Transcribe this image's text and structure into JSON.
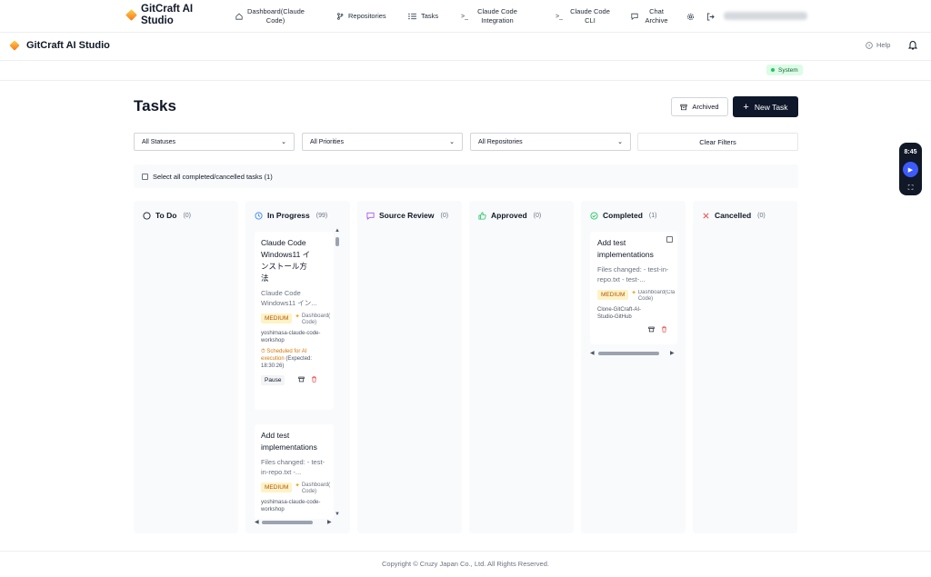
{
  "app": {
    "brand": "GitCraft AI Studio",
    "sub_brand": "GitCraft AI Studio"
  },
  "topnav": {
    "items": [
      {
        "label": "Dashboard(Claude Code)",
        "icon": "home-icon"
      },
      {
        "label": "Repositories",
        "icon": "branch-icon"
      },
      {
        "label": "Tasks",
        "icon": "list-icon"
      },
      {
        "label": "Claude Code Integration",
        "icon": "terminal-icon"
      },
      {
        "label": "Claude Code CLI",
        "icon": "terminal-icon"
      },
      {
        "label": "Chat Archive",
        "icon": "chat-icon"
      }
    ],
    "settings_icon": "gear-icon",
    "logout_icon": "logout-icon"
  },
  "subheader": {
    "help": "Help",
    "bell_icon": "bell-icon"
  },
  "system_badge": "System",
  "page": {
    "title": "Tasks",
    "archived_button": "Archived",
    "new_task_button": "New Task"
  },
  "filters": {
    "status": "All Statuses",
    "priority": "All Priorities",
    "repository": "All Repositories",
    "clear": "Clear Filters"
  },
  "select_all": "Select all completed/cancelled tasks (1)",
  "columns": [
    {
      "title": "To Do",
      "count": "(0)",
      "icon": "circle-icon",
      "color": "#111827"
    },
    {
      "title": "In Progress",
      "count": "(99)",
      "icon": "clock-icon",
      "color": "#3b82f6"
    },
    {
      "title": "Source Review",
      "count": "(0)",
      "icon": "message-icon",
      "color": "#a855f7"
    },
    {
      "title": "Approved",
      "count": "(0)",
      "icon": "thumbs-up-icon",
      "color": "#22c55e"
    },
    {
      "title": "Completed",
      "count": "(1)",
      "icon": "check-circle-icon",
      "color": "#22c55e"
    },
    {
      "title": "Cancelled",
      "count": "(0)",
      "icon": "x-icon",
      "color": "#ef4444"
    }
  ],
  "in_progress_cards": [
    {
      "title": "Claude Code Windows11 インストール方法",
      "desc": "Claude Code Windows11 イン...",
      "priority": "MEDIUM",
      "repo_tag": "Dashboard( Code)",
      "repo": "yoshimasa-claude-code-workshop",
      "scheduled": "Scheduled for AI execution",
      "expected": "(Expected: 18:30:26)",
      "pause": "Pause"
    },
    {
      "title": "Add test implementations",
      "desc": "Files changed: - test-in-repo.txt -...",
      "priority": "MEDIUM",
      "repo_tag": "Dashboard( Code)",
      "repo": "yoshimasa-claude-code-workshop"
    }
  ],
  "completed_card": {
    "title": "Add test implementations",
    "desc": "Files changed: - test-in-repo.txt - test-...",
    "priority": "MEDIUM",
    "repo_tag": "Dashboard(Cla Code)",
    "repo": "Clone-GitCraft-AI-Studio-GitHub"
  },
  "widget": {
    "time": "8:45"
  },
  "footer": "Copyright © Cruzy Japan Co., Ltd. All Rights Reserved."
}
